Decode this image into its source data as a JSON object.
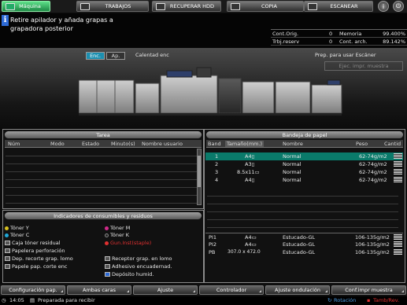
{
  "tabs": [
    {
      "label": "Máquina",
      "icon": "machine-icon",
      "active": true
    },
    {
      "label": "TRABAJOS",
      "icon": "jobs-icon",
      "active": false
    },
    {
      "label": "RECUPERAR HDD",
      "icon": "hdd-icon",
      "active": false
    },
    {
      "label": "COPIA",
      "icon": "copy-icon",
      "active": false
    },
    {
      "label": "ESCANEAR",
      "icon": "scan-icon",
      "active": false
    }
  ],
  "header_icons": [
    "info-icon",
    "power-icon"
  ],
  "message": {
    "icon": "info-icon",
    "text": "Retire apilador y añada grapas a grapadora posterior"
  },
  "counters": {
    "cont_orig_label": "Cont.Orig.",
    "cont_orig_value": "0",
    "trbj_label": "Trbj.reserv",
    "trbj_value": "0",
    "memoria_label": "Memoria",
    "memoria_value": "99.400%",
    "cont_arch_label": "Cont. arch.",
    "cont_arch_value": "89.142%"
  },
  "machine": {
    "enc_label": "Enc.",
    "ap_label": "Ap.",
    "calibration": "Calentad enc",
    "status": "Prep. para usar Escáner",
    "ejec_button": "Ejec. impr. muestra"
  },
  "tarea": {
    "title": "Tarea",
    "columns": [
      "Núm",
      "Modo",
      "Estado",
      "Minuto(s)",
      "Nombre usuario"
    ]
  },
  "bandeja": {
    "title": "Bandeja de papel",
    "columns": [
      "Band",
      "Tamaño(mm.)",
      "Nombre",
      "Peso",
      "Cantid"
    ],
    "rows": [
      {
        "band": "1",
        "size": "A4▯",
        "name": "Normal",
        "weight": "62-74g/m2",
        "selected": true
      },
      {
        "band": "2",
        "size": "A3▯",
        "name": "Normal",
        "weight": "62-74g/m2",
        "selected": false
      },
      {
        "band": "3",
        "size": "8.5x11▭",
        "name": "Normal",
        "weight": "62-74g/m2",
        "selected": false
      },
      {
        "band": "4",
        "size": "A4▯",
        "name": "Normal",
        "weight": "62-74g/m2",
        "selected": false
      }
    ],
    "extra_rows": [
      {
        "band": "PI1",
        "size": "A4▭",
        "name": "Estucado-GL",
        "weight": "106-135g/m2"
      },
      {
        "band": "PI2",
        "size": "A4▭",
        "name": "Estucado-GL",
        "weight": "106-135g/m2"
      },
      {
        "band": "PB",
        "size": "307.0 x 472.0",
        "name": "Estucado-GL",
        "weight": "106-135g/m2"
      }
    ]
  },
  "consumibles": {
    "title": "Indicadores de consumibles y residuos",
    "left": [
      {
        "label": "Tóner Y",
        "icon": "toner-y-icon",
        "color": "#d8c020"
      },
      {
        "label": "Tóner C",
        "icon": "toner-c-icon",
        "color": "#20a8d8"
      },
      {
        "label": "Caja tóner residual",
        "icon": "waste-box-icon",
        "color": "#888888"
      },
      {
        "label": "Papelera perforación",
        "icon": "punch-icon",
        "color": "#888888"
      },
      {
        "label": "Dep. recorte grap. lomo",
        "icon": "trim-icon",
        "color": "#888888"
      },
      {
        "label": "Papele pap. corte enc",
        "icon": "cut-icon",
        "color": "#888888"
      }
    ],
    "right": [
      {
        "label": "Tóner M",
        "icon": "toner-m-icon",
        "color": "#d02a8a",
        "alert": false
      },
      {
        "label": "Tóner K",
        "icon": "toner-k-icon",
        "color": "#222222",
        "alert": false
      },
      {
        "label": "Gun.Inst(staple)",
        "icon": "staple-icon",
        "color": "#e03030",
        "alert": true
      },
      {
        "label": "Receptor grap. en lomo",
        "icon": "receptor-icon",
        "color": "#888888",
        "alert": false
      },
      {
        "label": "Adhesivo encuadernad.",
        "icon": "adhesive-icon",
        "color": "#888888",
        "alert": false
      },
      {
        "label": "Depósito humid.",
        "icon": "tank-icon",
        "color": "#2d6ad6",
        "alert": false
      }
    ]
  },
  "bottom_buttons": [
    "Configuración pap.",
    "Ambas caras",
    "Ajuste",
    "Controlador",
    "Ajuste ondulación",
    "Conf.impr muestra"
  ],
  "statusbar": {
    "time": "14:05",
    "state": "Preparada para recibir",
    "rotation": "Rotación",
    "tamb": "Tamb/Rev."
  }
}
